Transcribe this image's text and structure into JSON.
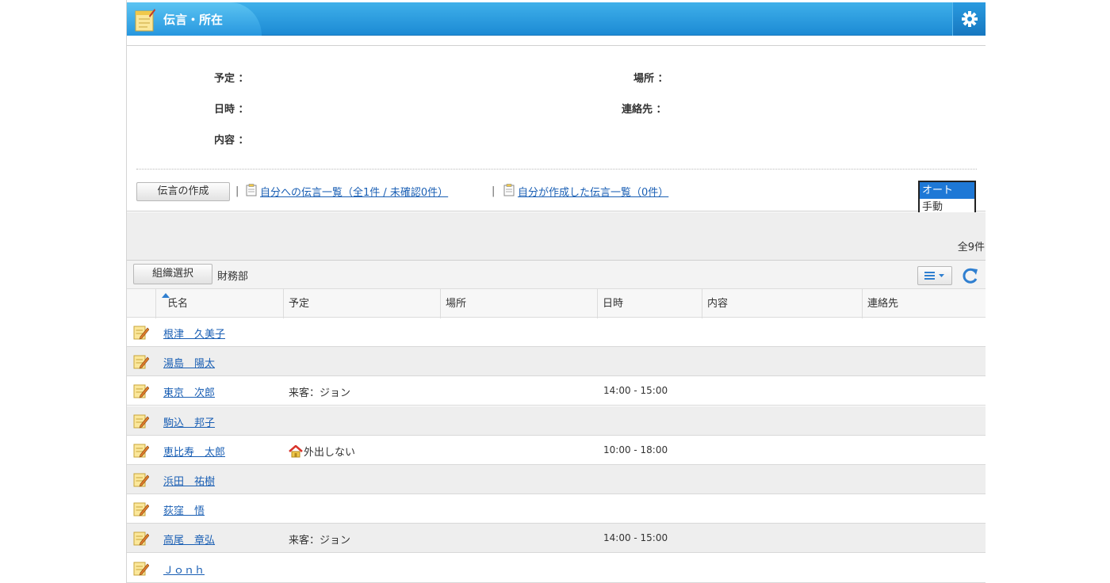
{
  "header": {
    "title": "伝言・所在"
  },
  "info": {
    "labels": {
      "schedule": "予定 ：",
      "datetime": "日時 ：",
      "content": "内容 ：",
      "place": "場所 ：",
      "contact": "連絡先 ："
    }
  },
  "actions": {
    "create_label": "伝言の作成",
    "sep": "|",
    "link_inbox": "自分への伝言一覧（全1件 / 未確認0件）",
    "link_sent": "自分が作成した伝言一覧（0件）"
  },
  "mode": {
    "options": [
      "オート",
      "手動"
    ],
    "selected": "オート"
  },
  "summary": {
    "total": "全9件"
  },
  "toolbar": {
    "org_select_label": "組織選択",
    "department": "財務部"
  },
  "table": {
    "columns": [
      "氏名",
      "予定",
      "場所",
      "日時",
      "内容",
      "連絡先"
    ],
    "sort_column": "氏名",
    "rows": [
      {
        "name": "根津　久美子",
        "schedule": "",
        "home_icon": false,
        "place": "",
        "time": "",
        "content": "",
        "contact": ""
      },
      {
        "name": "湯島　陽太",
        "schedule": "",
        "home_icon": false,
        "place": "",
        "time": "",
        "content": "",
        "contact": ""
      },
      {
        "name": "東京　次郎",
        "schedule": "来客：ジョン",
        "home_icon": false,
        "place": "",
        "time": "14:00 - 15:00",
        "content": "",
        "contact": ""
      },
      {
        "name": "駒込　邦子",
        "schedule": "",
        "home_icon": false,
        "place": "",
        "time": "",
        "content": "",
        "contact": ""
      },
      {
        "name": "恵比寿　太郎",
        "schedule": "外出しない",
        "home_icon": true,
        "place": "",
        "time": "10:00 - 18:00",
        "content": "",
        "contact": ""
      },
      {
        "name": "浜田　祐樹",
        "schedule": "",
        "home_icon": false,
        "place": "",
        "time": "",
        "content": "",
        "contact": ""
      },
      {
        "name": "荻窪　悟",
        "schedule": "",
        "home_icon": false,
        "place": "",
        "time": "",
        "content": "",
        "contact": ""
      },
      {
        "name": "高尾　章弘",
        "schedule": "来客：ジョン",
        "home_icon": false,
        "place": "",
        "time": "14:00 - 15:00",
        "content": "",
        "contact": ""
      },
      {
        "name": "Ｊｏｎｈ",
        "schedule": "",
        "home_icon": false,
        "place": "",
        "time": "",
        "content": "",
        "contact": ""
      }
    ]
  },
  "icons": {
    "header": "notepad-icon",
    "settings": "gear-icon",
    "row": "edit-note-icon",
    "link": "clipboard-icon",
    "menu": "list-menu-icon",
    "refresh": "refresh-icon",
    "sort": "sort-ascending-icon",
    "home": "home-icon"
  },
  "colors": {
    "header": "#1c8ad4",
    "link": "#1a5fb4",
    "selected_option": "#1e78d6"
  }
}
